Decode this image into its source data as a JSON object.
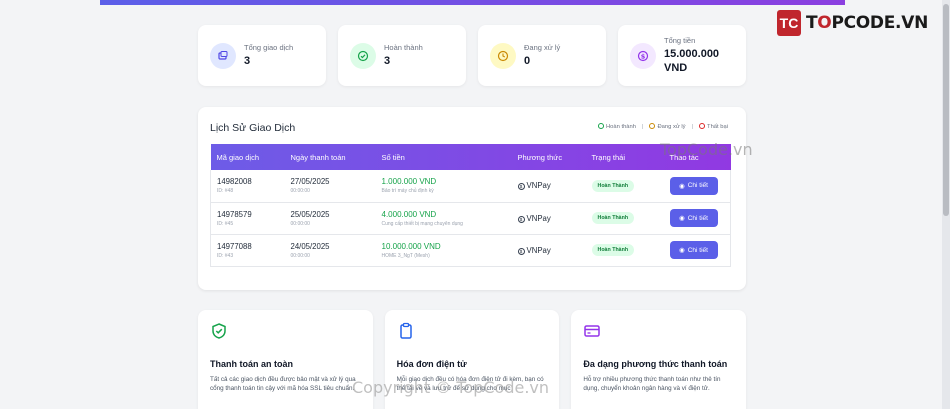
{
  "logo": {
    "mark": "TC",
    "text_a": "T",
    "text_o": "O",
    "text_b": "PCODE.VN"
  },
  "stats": [
    {
      "label": "Tổng giao dịch",
      "value": "3",
      "icon": "receipt-icon"
    },
    {
      "label": "Hoàn thành",
      "value": "3",
      "icon": "check-circle-icon"
    },
    {
      "label": "Đang xử lý",
      "value": "0",
      "icon": "clock-icon"
    },
    {
      "label": "Tổng tiền",
      "value": "15.000.000 VND",
      "icon": "dollar-icon"
    }
  ],
  "history": {
    "title": "Lịch Sử Giao Dịch",
    "legend": [
      {
        "label": "Hoàn thành",
        "color": "#16a34a"
      },
      {
        "label": "Đang xử lý",
        "color": "#ca8a04"
      },
      {
        "label": "Thất bại",
        "color": "#dc2626"
      }
    ],
    "columns": [
      "Mã giao dịch",
      "Ngày thanh toán",
      "Số tiền",
      "Phương thức",
      "Trạng thái",
      "Thao tác"
    ],
    "rows": [
      {
        "code": "14982008",
        "id": "ID: #48",
        "date": "27/05/2025",
        "time": "00:00:00",
        "amount": "1.000.000 VND",
        "desc": "Bảo trì máy chủ định kỳ",
        "method": "VNPay",
        "status": "Hoàn Thành",
        "action": "Chi tiết"
      },
      {
        "code": "14978579",
        "id": "ID: #45",
        "date": "25/05/2025",
        "time": "00:00:00",
        "amount": "4.000.000 VND",
        "desc": "Cung cấp thiết bị mạng chuyên dụng",
        "method": "VNPay",
        "status": "Hoàn Thành",
        "action": "Chi tiết"
      },
      {
        "code": "14977088",
        "id": "ID: #43",
        "date": "24/05/2025",
        "time": "00:00:00",
        "amount": "10.000.000 VND",
        "desc": "HOME 3_NgT (Mesh)",
        "method": "VNPay",
        "status": "Hoàn Thành",
        "action": "Chi tiết"
      }
    ]
  },
  "features": [
    {
      "title": "Thanh toán an toàn",
      "desc": "Tất cả các giao dịch đều được bảo mật và xử lý qua cổng thanh toán tin cậy với mã hóa SSL tiêu chuẩn.",
      "color": "#16a34a"
    },
    {
      "title": "Hóa đơn điện tử",
      "desc": "Mỗi giao dịch đều có hóa đơn điện tử đi kèm, bạn có thể tải về và lưu trữ để sử dụng cho mục",
      "color": "#2563eb"
    },
    {
      "title": "Đa dạng phương thức thanh toán",
      "desc": "Hỗ trợ nhiều phương thức thanh toán như thẻ tín dụng, chuyển khoản ngân hàng và ví điện tử.",
      "color": "#9333ea"
    }
  ],
  "watermarks": {
    "center": "TopCode.vn",
    "bottom": "Copyright © TopCode.vn"
  }
}
